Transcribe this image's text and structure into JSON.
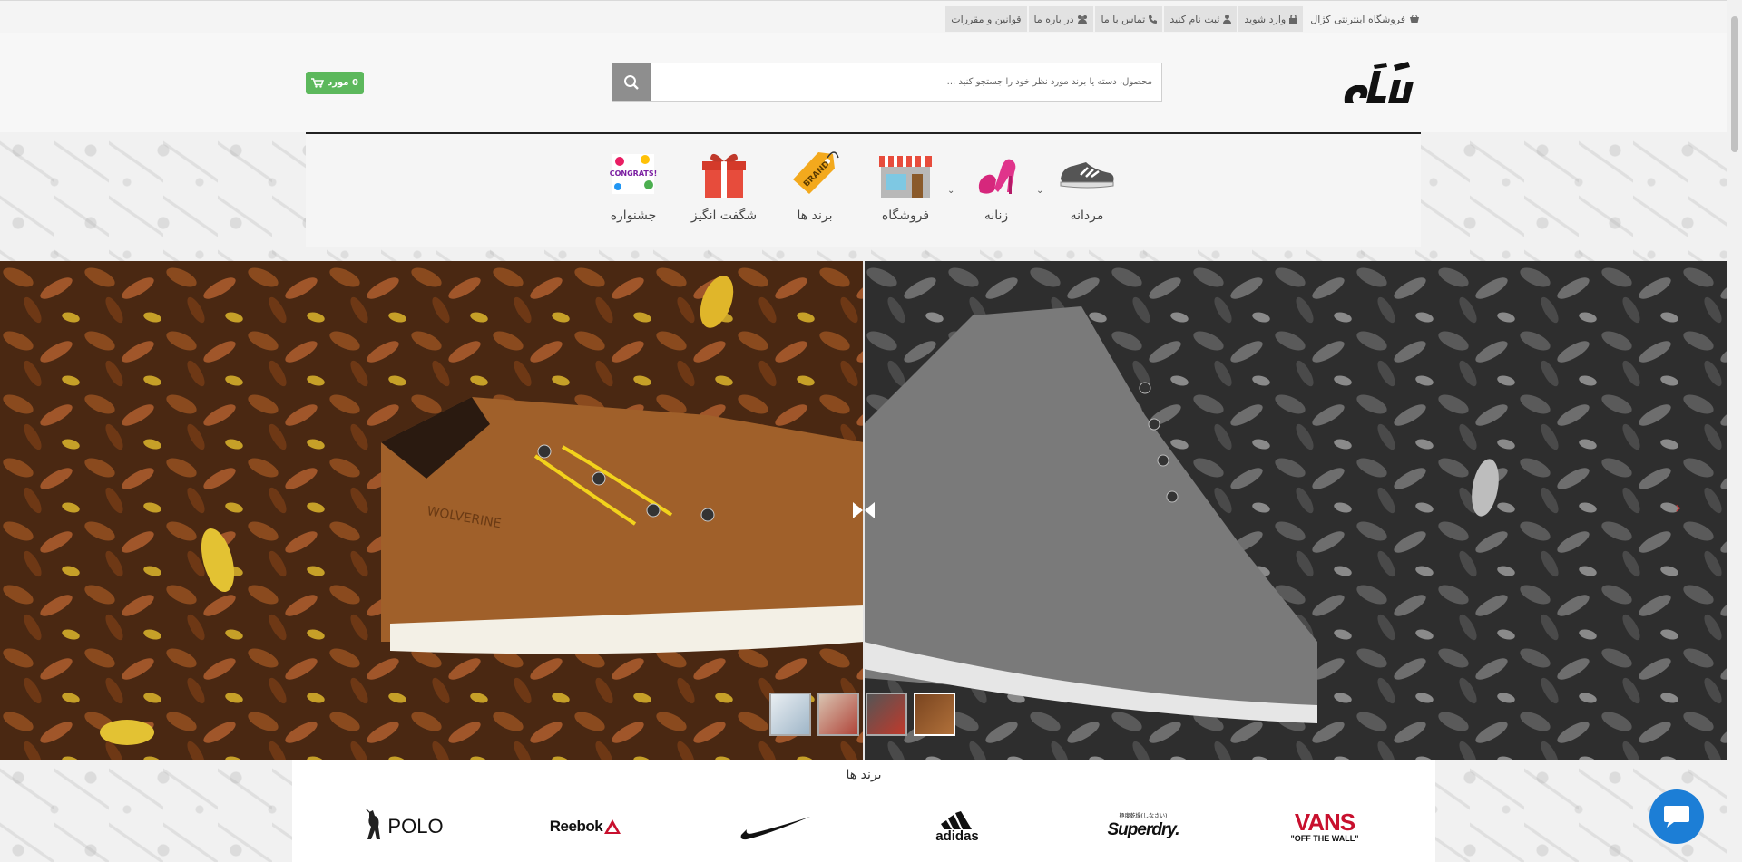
{
  "topbar": {
    "links": [
      {
        "label": "فروشگاه اینترنتی کژال",
        "icon": "basket-icon"
      },
      {
        "label": "وارد شوید",
        "icon": "lock-icon"
      },
      {
        "label": "ثبت نام کنید",
        "icon": "user-icon"
      },
      {
        "label": "تماس با ما",
        "icon": "phone-icon"
      },
      {
        "label": "در باره ما",
        "icon": "group-icon"
      },
      {
        "label": "قوانین و مقررات",
        "icon": ""
      }
    ]
  },
  "header": {
    "logo_text": "کژال",
    "search_placeholder": "محصول، دسته یا برند مورد نظر خود را جستجو کنید ...",
    "cart_label": "0 مورد"
  },
  "nav": {
    "items": [
      {
        "label": "مردانه",
        "icon": "mens-shoe-icon",
        "has_dropdown": true
      },
      {
        "label": "زنانه",
        "icon": "womens-shoe-icon",
        "has_dropdown": true
      },
      {
        "label": "فروشگاه",
        "icon": "store-icon",
        "has_dropdown": false
      },
      {
        "label": "برند ها",
        "icon": "brand-tag-icon",
        "has_dropdown": false
      },
      {
        "label": "شگفت انگیز",
        "icon": "gift-icon",
        "has_dropdown": false
      },
      {
        "label": "جشنواره",
        "icon": "festival-icon",
        "has_dropdown": false
      }
    ],
    "brand_tag_text": "BRAND",
    "festival_icon_text": "CONGRATS!"
  },
  "hero": {
    "shoe_brand_text": "WOLVERINE",
    "thumbnails": 4,
    "active_thumbnail": 4,
    "colors": {
      "left": "#5a3318",
      "right": "#3d3d3d"
    }
  },
  "brands": {
    "title": "برند ها",
    "logos": [
      {
        "name": "POLO"
      },
      {
        "name": "Reebok"
      },
      {
        "name": "nike"
      },
      {
        "name": "adidas"
      },
      {
        "name": "Superdry."
      },
      {
        "name": "VANS",
        "tagline": "\"OFF THE WALL\""
      }
    ],
    "superdry_japanese": "極度乾燥(しなさい)"
  },
  "colors": {
    "accent_green": "#5cb85c",
    "search_button": "#8e8e8e",
    "chat": "#1c7ed6"
  }
}
